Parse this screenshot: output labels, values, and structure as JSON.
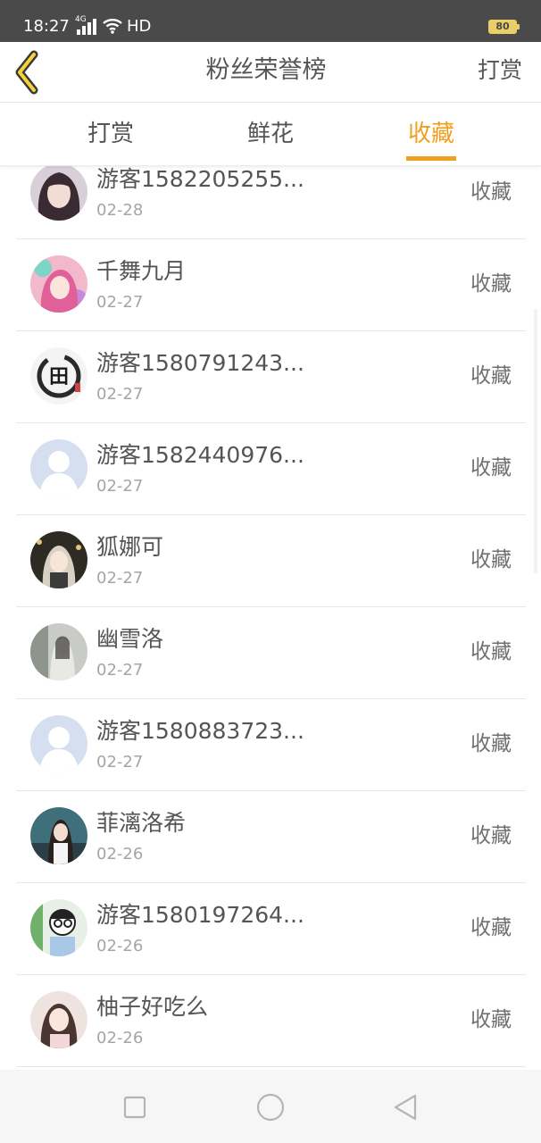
{
  "status_bar": {
    "time": "18:27",
    "network": "4G",
    "hd": "HD",
    "battery": "80",
    "battery_color": "#e8cf6a"
  },
  "header": {
    "back_icon": "chevron-left-icon",
    "title": "粉丝荣誉榜",
    "action": "打赏",
    "accent_color": "#f0a020"
  },
  "tabs": [
    {
      "label": "打赏",
      "active": false
    },
    {
      "label": "鲜花",
      "active": false
    },
    {
      "label": "收藏",
      "active": true
    }
  ],
  "list": [
    {
      "name": "游客1582205255...",
      "date": "02-28",
      "action": "收藏"
    },
    {
      "name": "千舞九月",
      "date": "02-27",
      "action": "收藏"
    },
    {
      "name": "游客1580791243...",
      "date": "02-27",
      "action": "收藏"
    },
    {
      "name": "游客1582440976...",
      "date": "02-27",
      "action": "收藏"
    },
    {
      "name": "狐娜可",
      "date": "02-27",
      "action": "收藏"
    },
    {
      "name": "幽雪洛",
      "date": "02-27",
      "action": "收藏"
    },
    {
      "name": "游客1580883723...",
      "date": "02-27",
      "action": "收藏"
    },
    {
      "name": "菲漓洛希",
      "date": "02-26",
      "action": "收藏"
    },
    {
      "name": "游客1580197264...",
      "date": "02-26",
      "action": "收藏"
    },
    {
      "name": "柚子好吃么",
      "date": "02-26",
      "action": "收藏"
    }
  ],
  "avatar_logo_char": "田",
  "nav_bar": {
    "icons": [
      "recent-apps-icon",
      "home-icon",
      "back-triangle-icon"
    ]
  }
}
